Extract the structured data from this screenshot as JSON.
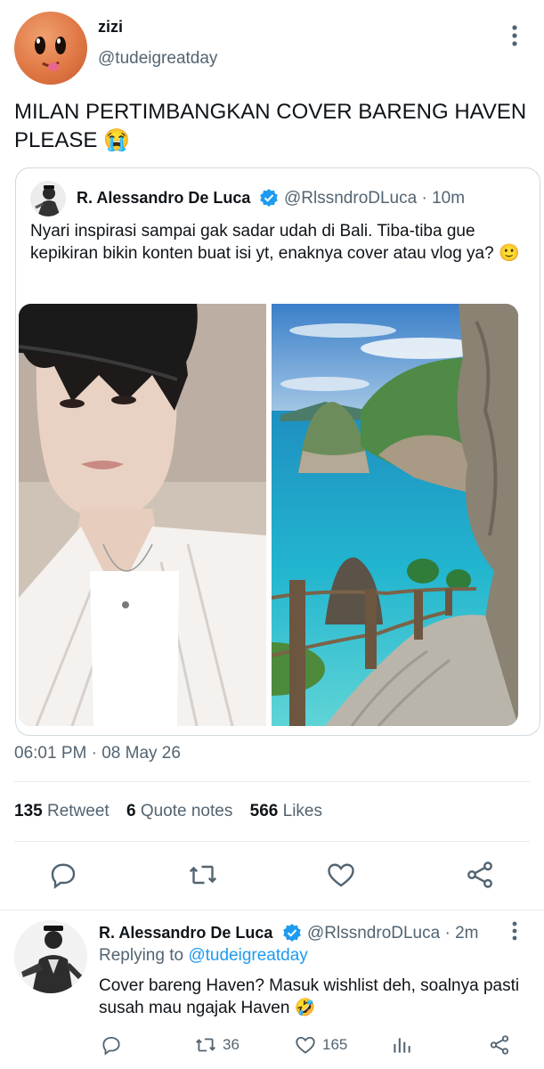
{
  "tweet": {
    "author_name": "zizi",
    "author_handle": "@tudeigreatday",
    "text": "MILAN PERTIMBANGKAN COVER BARENG HAVEN PLEASE 😭",
    "timestamp": "06:01 PM · 08 May 26",
    "stats": {
      "retweets_count": "135",
      "retweets_label": "Retweet",
      "quotes_count": "6",
      "quotes_label": "Quote notes",
      "likes_count": "566",
      "likes_label": "Likes"
    }
  },
  "quoted": {
    "author_name": "R. Alessandro De Luca",
    "author_handle_time": "@RlssndroDLuca · 10m",
    "text": "Nyari inspirasi sampai gak sadar udah di Bali. Tiba-tiba gue kepikiran bikin konten buat isi yt, enaknya cover atau vlog ya? 🙂"
  },
  "reply": {
    "author_name": "R. Alessandro De Luca",
    "author_handle_time": "@RlssndroDLuca · 2m",
    "replying_prefix": "Replying to",
    "replying_handle": "@tudeigreatday",
    "text": "Cover bareng Haven? Masuk wishlist deh, soalnya pasti susah mau ngajak Haven 🤣",
    "retweet_count": "36",
    "like_count": "165"
  },
  "colors": {
    "accent": "#1d9bf0",
    "secondary_text": "#536471",
    "divider": "#e6ecf0"
  },
  "icons": [
    "more-vertical-icon",
    "verified-icon",
    "reply-icon",
    "retweet-icon",
    "like-icon",
    "share-icon",
    "views-icon"
  ]
}
